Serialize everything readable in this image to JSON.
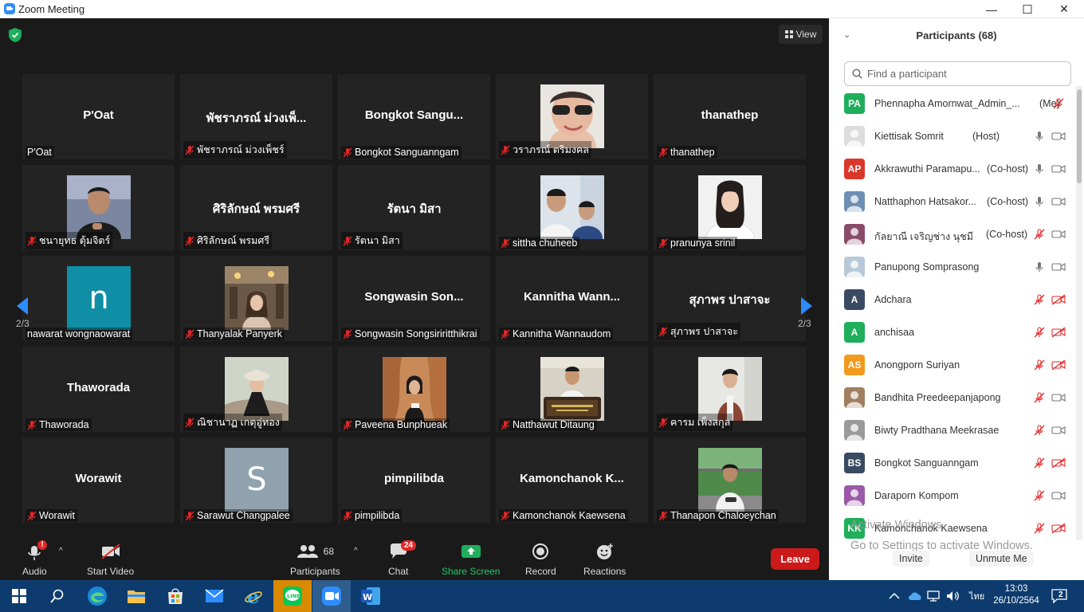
{
  "window": {
    "title": "Zoom Meeting",
    "minimize": "—",
    "maximize": "☐",
    "close": "✕"
  },
  "view_label": "View",
  "pager": {
    "left": "2/3",
    "right": "2/3"
  },
  "tiles": [
    {
      "name": "P'Oat",
      "big": "P'Oat",
      "muted": false,
      "photo": null
    },
    {
      "name": "พัชราภรณ์ ม่วงเพ็ชร์",
      "big": "พัชราภรณ์ ม่วงเพ็...",
      "muted": true,
      "photo": null
    },
    {
      "name": "Bongkot Sanguanngam",
      "big": "Bongkot  Sangu...",
      "muted": true,
      "photo": null
    },
    {
      "name": "วราภรณ์ ตริมงคล",
      "big": "",
      "muted": true,
      "photo": "woman-sunglasses"
    },
    {
      "name": "thanathep",
      "big": "thanathep",
      "muted": true,
      "photo": null
    },
    {
      "name": "ชนายุทธ ตุ้มจิตร์",
      "big": "",
      "muted": true,
      "photo": "man-black"
    },
    {
      "name": "ศิริลักษณ์ พรมศรี",
      "big": "ศิริลักษณ์ พรมศรี",
      "muted": true,
      "photo": null
    },
    {
      "name": "รัตนา มิสา",
      "big": "รัตนา มิสา",
      "muted": true,
      "photo": null
    },
    {
      "name": "sittha chuheeb",
      "big": "",
      "muted": true,
      "photo": "two-students"
    },
    {
      "name": "pranunya srinil",
      "big": "",
      "muted": true,
      "photo": "girl-white"
    },
    {
      "name": "nawarat wongnaowarat",
      "big": "",
      "muted": false,
      "photo": "letter-n"
    },
    {
      "name": "Thanyalak Panyerk",
      "big": "",
      "muted": true,
      "photo": "cafe-girl"
    },
    {
      "name": "Songwasin Songsiriritthikrai",
      "big": "Songwasin  Son...",
      "muted": true,
      "photo": null
    },
    {
      "name": "Kannitha Wannaudom",
      "big": "Kannitha  Wann...",
      "muted": true,
      "photo": null
    },
    {
      "name": "สุภาพร ปาสาจะ",
      "big": "สุภาพร ปาสาจะ",
      "muted": true,
      "photo": null
    },
    {
      "name": "Thaworada",
      "big": "Thaworada",
      "muted": true,
      "photo": null
    },
    {
      "name": "ณิชานาฏ เกตุอู่ทอง",
      "big": "",
      "muted": true,
      "photo": "girl-rock"
    },
    {
      "name": "Paveena Bunphueak",
      "big": "",
      "muted": true,
      "photo": "girl-canyon"
    },
    {
      "name": "Natthawut Ditaung",
      "big": "",
      "muted": true,
      "photo": "man-sign"
    },
    {
      "name": "คารม เพ็งสกุล",
      "big": "",
      "muted": true,
      "photo": "man-wall"
    },
    {
      "name": "Worawit",
      "big": "Worawit",
      "muted": true,
      "photo": null
    },
    {
      "name": "Sarawut Changpalee",
      "big": "",
      "muted": true,
      "photo": "letter-s"
    },
    {
      "name": "pimpilibda",
      "big": "pimpilibda",
      "muted": true,
      "photo": null
    },
    {
      "name": "Kamonchanok Kaewsena",
      "big": "Kamonchanok  K...",
      "muted": true,
      "photo": null
    },
    {
      "name": "Thanapon Chaloeychan",
      "big": "",
      "muted": true,
      "photo": "man-trees"
    }
  ],
  "photo_letters": {
    "letter-n": "n",
    "letter-s": "S"
  },
  "toolbar": {
    "audio": "Audio",
    "audio_alert": "!",
    "start_video": "Start Video",
    "participants": "Participants",
    "participants_count": "68",
    "chat": "Chat",
    "chat_badge": "24",
    "share_screen": "Share Screen",
    "record": "Record",
    "reactions": "Reactions",
    "leave": "Leave"
  },
  "panel": {
    "title": "Participants (68)",
    "search_placeholder": "Find a participant",
    "participants": [
      {
        "initials": "PA",
        "color": "#1fae5b",
        "name": "Phennapha Amornwat_Admin_...",
        "role": "(Me)",
        "mic": "muted-red",
        "video": "none"
      },
      {
        "initials": "",
        "color": "#dddddd",
        "name": "Kiettisak Somrit",
        "role": "(Host)",
        "mic": "on",
        "video": "on"
      },
      {
        "initials": "AP",
        "color": "#d9382b",
        "name": "Akkrawuthi Paramapu...",
        "role": "(Co-host)",
        "mic": "on",
        "video": "on"
      },
      {
        "initials": "",
        "color": "#6d8fb3",
        "name": "Natthaphon Hatsakor...",
        "role": "(Co-host)",
        "mic": "on",
        "video": "on"
      },
      {
        "initials": "",
        "color": "#8a4b67",
        "name": "กัลยาณี เจริญช่าง นุชมี",
        "role": "(Co-host)",
        "mic": "muted-red",
        "video": "on"
      },
      {
        "initials": "",
        "color": "#b8c9d8",
        "name": "Panupong Somprasong",
        "role": "",
        "mic": "on",
        "video": "on"
      },
      {
        "initials": "A",
        "color": "#3b4a63",
        "name": "Adchara",
        "role": "",
        "mic": "muted-red",
        "video": "off-red"
      },
      {
        "initials": "A",
        "color": "#1fae5b",
        "name": "anchisaa",
        "role": "",
        "mic": "muted-red",
        "video": "off-red"
      },
      {
        "initials": "AS",
        "color": "#f29a1b",
        "name": "Anongporn Suriyan",
        "role": "",
        "mic": "muted-red",
        "video": "off-red"
      },
      {
        "initials": "",
        "color": "#a08060",
        "name": "Bandhita Preedeepanjapong",
        "role": "",
        "mic": "muted-red",
        "video": "on"
      },
      {
        "initials": "",
        "color": "#9a9a9a",
        "name": "Biwty Pradthana Meekrasae",
        "role": "",
        "mic": "muted-red",
        "video": "on"
      },
      {
        "initials": "BS",
        "color": "#3b4a63",
        "name": "Bongkot Sanguanngam",
        "role": "",
        "mic": "muted-red",
        "video": "off-red"
      },
      {
        "initials": "",
        "color": "#9a5aa8",
        "name": "Daraporn Kompom",
        "role": "",
        "mic": "muted-red",
        "video": "on"
      },
      {
        "initials": "KK",
        "color": "#1fae5b",
        "name": "Kamonchanok Kaewsena",
        "role": "",
        "mic": "muted-red",
        "video": "off-red"
      }
    ],
    "watermark_line1": "Activate Windows",
    "watermark_line2": "Go to Settings to activate Windows.",
    "invite": "Invite",
    "unmute_me": "Unmute Me"
  },
  "taskbar": {
    "language": "ไทย",
    "time": "13:03",
    "date": "26/10/2564",
    "notifications": "2"
  }
}
